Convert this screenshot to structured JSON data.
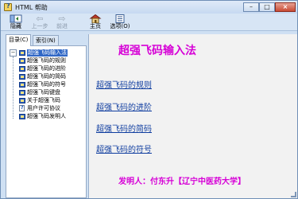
{
  "window": {
    "title": "HTML 帮助",
    "controls": {
      "minimize": "–",
      "maximize": "□",
      "close": "×"
    }
  },
  "toolbar": {
    "hide_label": "隐藏",
    "back_label": "上一步",
    "forward_label": "前进",
    "home_label": "主页",
    "options_label": "选项(O)"
  },
  "nav": {
    "tabs": {
      "contents": "目录(C)",
      "index": "索引(N)"
    },
    "tree": [
      {
        "label": "超强飞码输入法",
        "icon": "book-icon"
      },
      {
        "label": "超强飞码的规则",
        "icon": "book-icon"
      },
      {
        "label": "超强飞码的进阶",
        "icon": "book-icon"
      },
      {
        "label": "超强飞码的简码",
        "icon": "book-icon"
      },
      {
        "label": "超强飞码的符号",
        "icon": "book-icon"
      },
      {
        "label": "超强飞码键盘",
        "icon": "book-icon"
      },
      {
        "label": "关于超强飞码",
        "icon": "book-icon"
      },
      {
        "label": "用户许可协议",
        "icon": "document-icon"
      },
      {
        "label": "超强飞码发明人",
        "icon": "book-icon"
      }
    ]
  },
  "content": {
    "heading": "超强飞码输入法",
    "links": [
      "超强飞码的规则",
      "超强飞码的进阶",
      "超强飞码的简码",
      "超强飞码的符号"
    ],
    "author_line": "发明人：付东升【辽宁中医药大学】"
  },
  "colors": {
    "heading_magenta": "#d600d6",
    "link_blue": "#103ea0",
    "selection_blue": "#3168c6"
  }
}
